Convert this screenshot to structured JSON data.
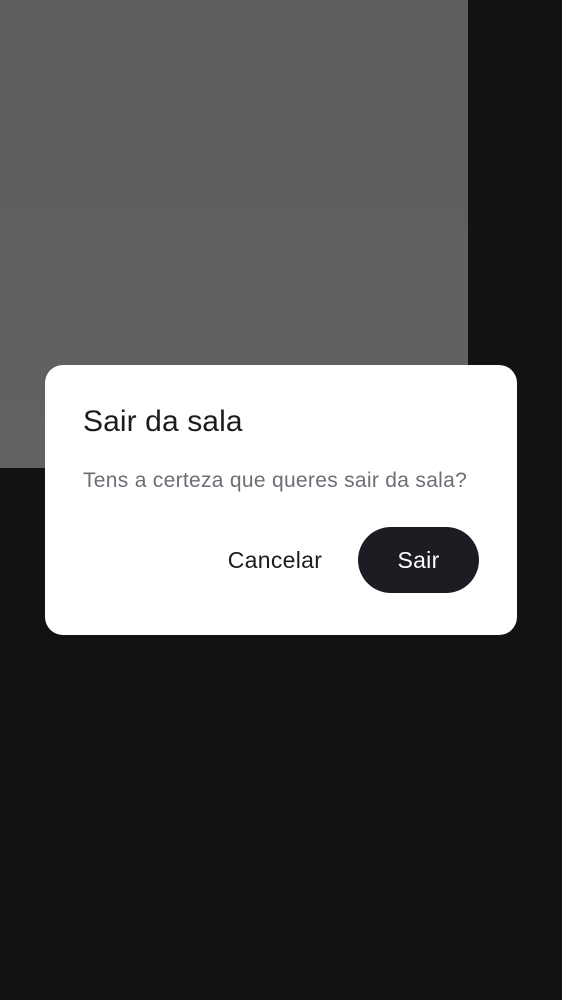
{
  "dialog": {
    "title": "Sair da sala",
    "message": "Tens a certeza que queres sair da sala?",
    "cancel_label": "Cancelar",
    "confirm_label": "Sair"
  },
  "colors": {
    "background": "#121212",
    "video_tile": "#5f5f5f",
    "dialog_surface": "#ffffff",
    "primary_button": "#1b1d22"
  }
}
